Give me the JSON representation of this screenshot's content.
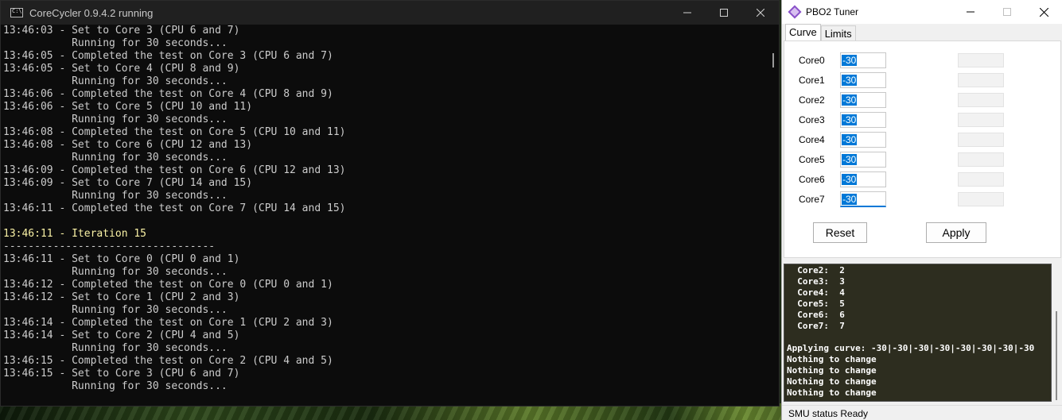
{
  "console": {
    "title": "CoreCycler 0.9.4.2 running",
    "lines": [
      {
        "text": "13:46:03 - Set to Core 3 (CPU 6 and 7)",
        "highlight": false
      },
      {
        "text": "           Running for 30 seconds...",
        "highlight": false
      },
      {
        "text": "13:46:05 - Completed the test on Core 3 (CPU 6 and 7)",
        "highlight": false
      },
      {
        "text": "13:46:05 - Set to Core 4 (CPU 8 and 9)",
        "highlight": false
      },
      {
        "text": "           Running for 30 seconds...",
        "highlight": false
      },
      {
        "text": "13:46:06 - Completed the test on Core 4 (CPU 8 and 9)",
        "highlight": false
      },
      {
        "text": "13:46:06 - Set to Core 5 (CPU 10 and 11)",
        "highlight": false
      },
      {
        "text": "           Running for 30 seconds...",
        "highlight": false
      },
      {
        "text": "13:46:08 - Completed the test on Core 5 (CPU 10 and 11)",
        "highlight": false
      },
      {
        "text": "13:46:08 - Set to Core 6 (CPU 12 and 13)",
        "highlight": false
      },
      {
        "text": "           Running for 30 seconds...",
        "highlight": false
      },
      {
        "text": "13:46:09 - Completed the test on Core 6 (CPU 12 and 13)",
        "highlight": false
      },
      {
        "text": "13:46:09 - Set to Core 7 (CPU 14 and 15)",
        "highlight": false
      },
      {
        "text": "           Running for 30 seconds...",
        "highlight": false
      },
      {
        "text": "13:46:11 - Completed the test on Core 7 (CPU 14 and 15)",
        "highlight": false
      },
      {
        "text": "",
        "highlight": false
      },
      {
        "text": "13:46:11 - Iteration 15",
        "highlight": true
      },
      {
        "text": "----------------------------------",
        "highlight": false
      },
      {
        "text": "13:46:11 - Set to Core 0 (CPU 0 and 1)",
        "highlight": false
      },
      {
        "text": "           Running for 30 seconds...",
        "highlight": false
      },
      {
        "text": "13:46:12 - Completed the test on Core 0 (CPU 0 and 1)",
        "highlight": false
      },
      {
        "text": "13:46:12 - Set to Core 1 (CPU 2 and 3)",
        "highlight": false
      },
      {
        "text": "           Running for 30 seconds...",
        "highlight": false
      },
      {
        "text": "13:46:14 - Completed the test on Core 1 (CPU 2 and 3)",
        "highlight": false
      },
      {
        "text": "13:46:14 - Set to Core 2 (CPU 4 and 5)",
        "highlight": false
      },
      {
        "text": "           Running for 30 seconds...",
        "highlight": false
      },
      {
        "text": "13:46:15 - Completed the test on Core 2 (CPU 4 and 5)",
        "highlight": false
      },
      {
        "text": "13:46:15 - Set to Core 3 (CPU 6 and 7)",
        "highlight": false
      },
      {
        "text": "           Running for 30 seconds...",
        "highlight": false
      }
    ]
  },
  "tuner": {
    "title": "PBO2 Tuner",
    "tabs": [
      "Curve",
      "Limits"
    ],
    "active_tab": "Curve",
    "cores": [
      {
        "label": "Core0",
        "value": "-30"
      },
      {
        "label": "Core1",
        "value": "-30"
      },
      {
        "label": "Core2",
        "value": "-30"
      },
      {
        "label": "Core3",
        "value": "-30"
      },
      {
        "label": "Core4",
        "value": "-30"
      },
      {
        "label": "Core5",
        "value": "-30"
      },
      {
        "label": "Core6",
        "value": "-30"
      },
      {
        "label": "Core7",
        "value": "-30"
      }
    ],
    "reset_label": "Reset",
    "apply_label": "Apply",
    "log_lines": [
      "  Core2:  2",
      "  Core3:  3",
      "  Core4:  4",
      "  Core5:  5",
      "  Core6:  6",
      "  Core7:  7",
      "",
      "Applying curve: -30|-30|-30|-30|-30|-30|-30|-30",
      "Nothing to change",
      "Nothing to change",
      "Nothing to change",
      "Nothing to change"
    ],
    "status": "SMU status Ready"
  }
}
